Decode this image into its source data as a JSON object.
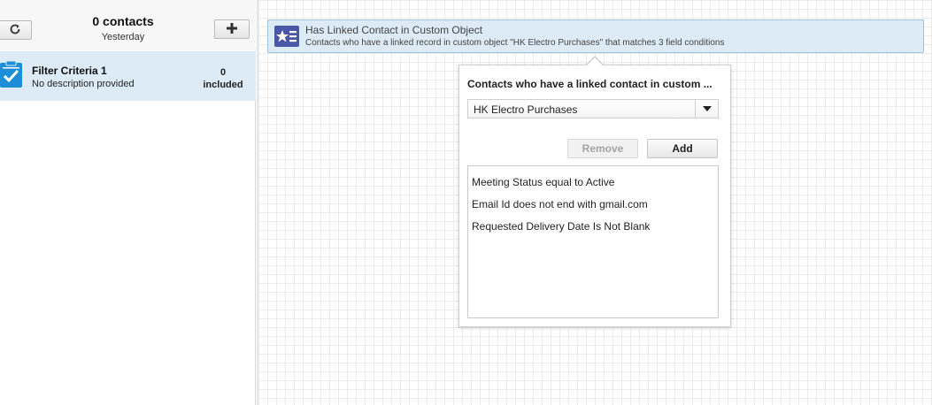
{
  "sidebar": {
    "contacts_count": "0 contacts",
    "last_updated": "Yesterday",
    "criteria": [
      {
        "title": "Filter Criteria 1",
        "description": "No description provided",
        "count": "0",
        "count_label": "included"
      }
    ]
  },
  "filter_card": {
    "title": "Has Linked Contact in Custom Object",
    "description": "Contacts who have a linked record in custom object \"HK Electro Purchases\" that matches 3 field conditions"
  },
  "popover": {
    "title": "Contacts who have a linked contact in custom ...",
    "selected_object": "HK Electro Purchases",
    "remove_label": "Remove",
    "add_label": "Add",
    "conditions": [
      "Meeting Status equal to Active",
      "Email Id does not end with gmail.com",
      "Requested Delivery Date Is Not Blank"
    ]
  },
  "icons": {
    "refresh": "refresh-icon",
    "add": "plus-icon",
    "criteria": "clipboard-check-icon",
    "filter": "star-list-icon",
    "dropdown": "caret-down-icon"
  },
  "colors": {
    "selected_row": "#dcebf6",
    "accent_blue": "#1c8ed6",
    "filter_icon_bg": "#4a56a6"
  }
}
